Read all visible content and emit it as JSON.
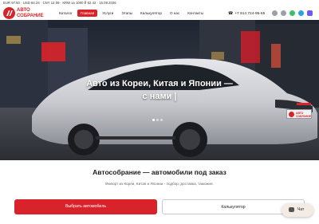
{
  "infobar": {
    "rates": "EUR 97.50 · USD 84.24 · CNY 12.09 · KRW за 1000 ₽ 62.42 · 15.09.2026"
  },
  "brand": {
    "line1": "АВТО",
    "line2": "СОБРАНИЕ",
    "accent_color": "#d8232a"
  },
  "nav": {
    "items": [
      {
        "label": "Каталог",
        "active": false
      },
      {
        "label": "Главная",
        "active": true
      },
      {
        "label": "Услуги",
        "active": false
      },
      {
        "label": "Этапы",
        "active": false
      },
      {
        "label": "Калькулятор",
        "active": false
      },
      {
        "label": "О нас",
        "active": false
      },
      {
        "label": "Контакты",
        "active": false
      }
    ]
  },
  "contacts": {
    "phone": "+7 914 724-95-65",
    "icons": [
      "phone-icon",
      "vk-icon",
      "odnoklassniki-icon",
      "whatsapp-icon",
      "telegram-icon",
      "max-messenger-icon"
    ]
  },
  "hero": {
    "title_line1": "Авто из Кореи, Китая и Японии —",
    "title_line2": "с нами |",
    "slides": 3,
    "active_slide": 1,
    "plate_line1": "АВТО",
    "plate_line2": "СОБРАНИЕ"
  },
  "section": {
    "title": "Автособрание — автомобили под заказ",
    "subtitle": "Импорт из Кореи, Китая и Японии - подбор, доставка, таможня."
  },
  "buttons": {
    "primary": "Выбрать автомобиль",
    "secondary": "Калькулятор"
  },
  "chat": {
    "label": "Чат"
  }
}
